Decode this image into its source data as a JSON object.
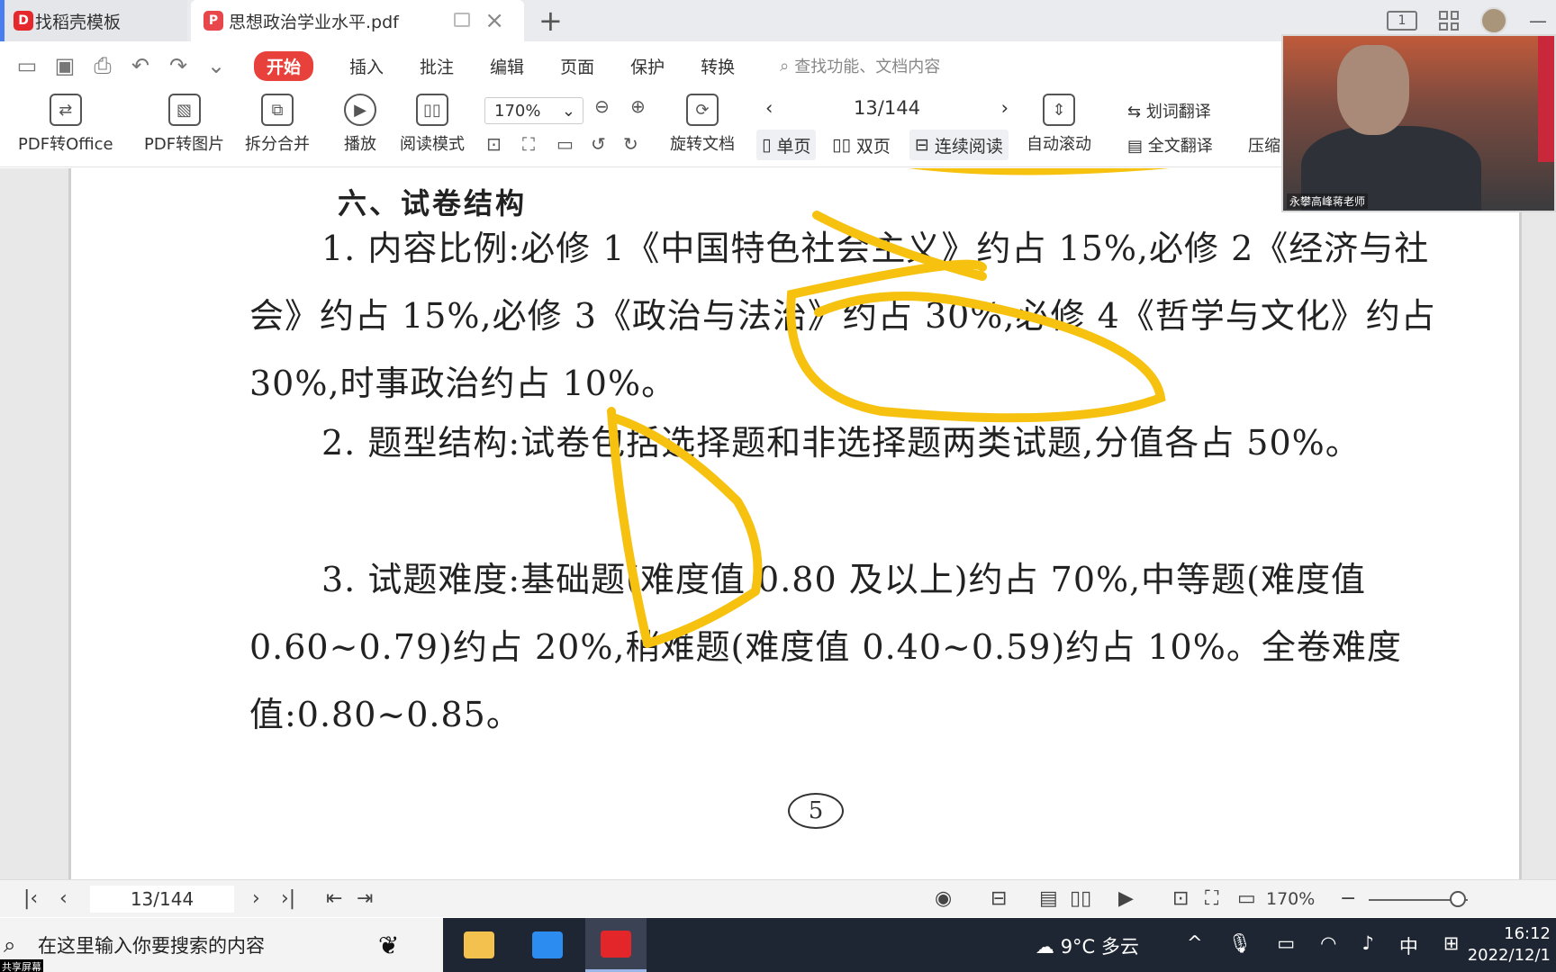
{
  "tabs": [
    {
      "label": "找稻壳模板",
      "active": false
    },
    {
      "label": "思想政治学业水平.pdf",
      "active": true
    }
  ],
  "window": {
    "page_mode_label": "1"
  },
  "menu": {
    "items": [
      "开始",
      "插入",
      "批注",
      "编辑",
      "页面",
      "保护",
      "转换"
    ],
    "search_placeholder": "查找功能、文档内容"
  },
  "ribbon": {
    "pdf_to_office": "PDF转Office",
    "pdf_to_image": "PDF转图片",
    "split_merge": "拆分合并",
    "play": "播放",
    "read_mode": "阅读模式",
    "zoom": "170%",
    "rotate": "旋转文档",
    "page_indicator": "13/144",
    "single_page": "单页",
    "double_page": "双页",
    "continuous": "连续阅读",
    "auto_scroll": "自动滚动",
    "word_translate": "划词翻译",
    "full_translate": "全文翻译",
    "compress": "压缩"
  },
  "video": {
    "name": "永攀高峰蒋老师"
  },
  "document": {
    "heading": "六、试卷结构",
    "paragraphs": [
      "1. 内容比例:必修 1《中国特色社会主义》约占 15%,必修 2《经济与社会》约占 15%,必修 3《政治与法治》约占 30%,必修 4《哲学与文化》约占 30%,时事政治约占 10%。",
      "2. 题型结构:试卷包括选择题和非选择题两类试题,分值各占 50%。",
      "3. 试题难度:基础题(难度值 0.80 及以上)约占 70%,中等题(难度值 0.60~0.79)约占 20%,稍难题(难度值 0.40~0.59)约占 10%。全卷难度值:0.80~0.85。"
    ],
    "page_number": "5"
  },
  "statusbar": {
    "page": "13/144",
    "zoom": "170%",
    "zoom_level": 0.9
  },
  "taskbar": {
    "search_placeholder": "在这里输入你要搜索的内容",
    "weather": "9°C 多云",
    "ime": "中",
    "time": "16:12",
    "date": "2022/12/1",
    "share_label": "共享屏幕"
  }
}
